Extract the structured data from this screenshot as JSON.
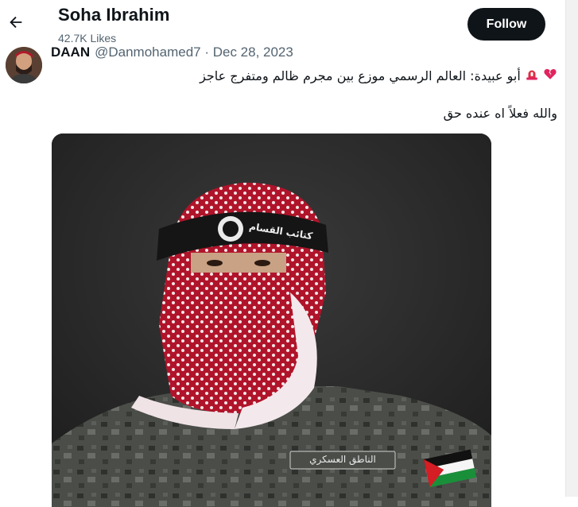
{
  "header": {
    "title": "Soha Ibrahim",
    "likes": "42.7K Likes",
    "follow_label": "Follow"
  },
  "tweet": {
    "author_name": "DAAN",
    "meta": "@Danmohamed7 · Dec 28, 2023",
    "text_line1": "أبو عبيدة: العالم الرسمي موزع بين مجرم ظالم ومتفرج عاجز",
    "text_line2": "والله فعلاً اه عنده حق",
    "media_caption_badge": "الناطق العسكري",
    "media_headband_text": "كتائب القسام"
  },
  "colors": {
    "follow_bg": "#0f1419",
    "secondary_text": "#536471",
    "keffiyeh_red": "#b0142a"
  },
  "icons": {
    "back": "arrow-left-icon",
    "broken_heart": "broken-heart-icon",
    "siren": "siren-icon"
  }
}
